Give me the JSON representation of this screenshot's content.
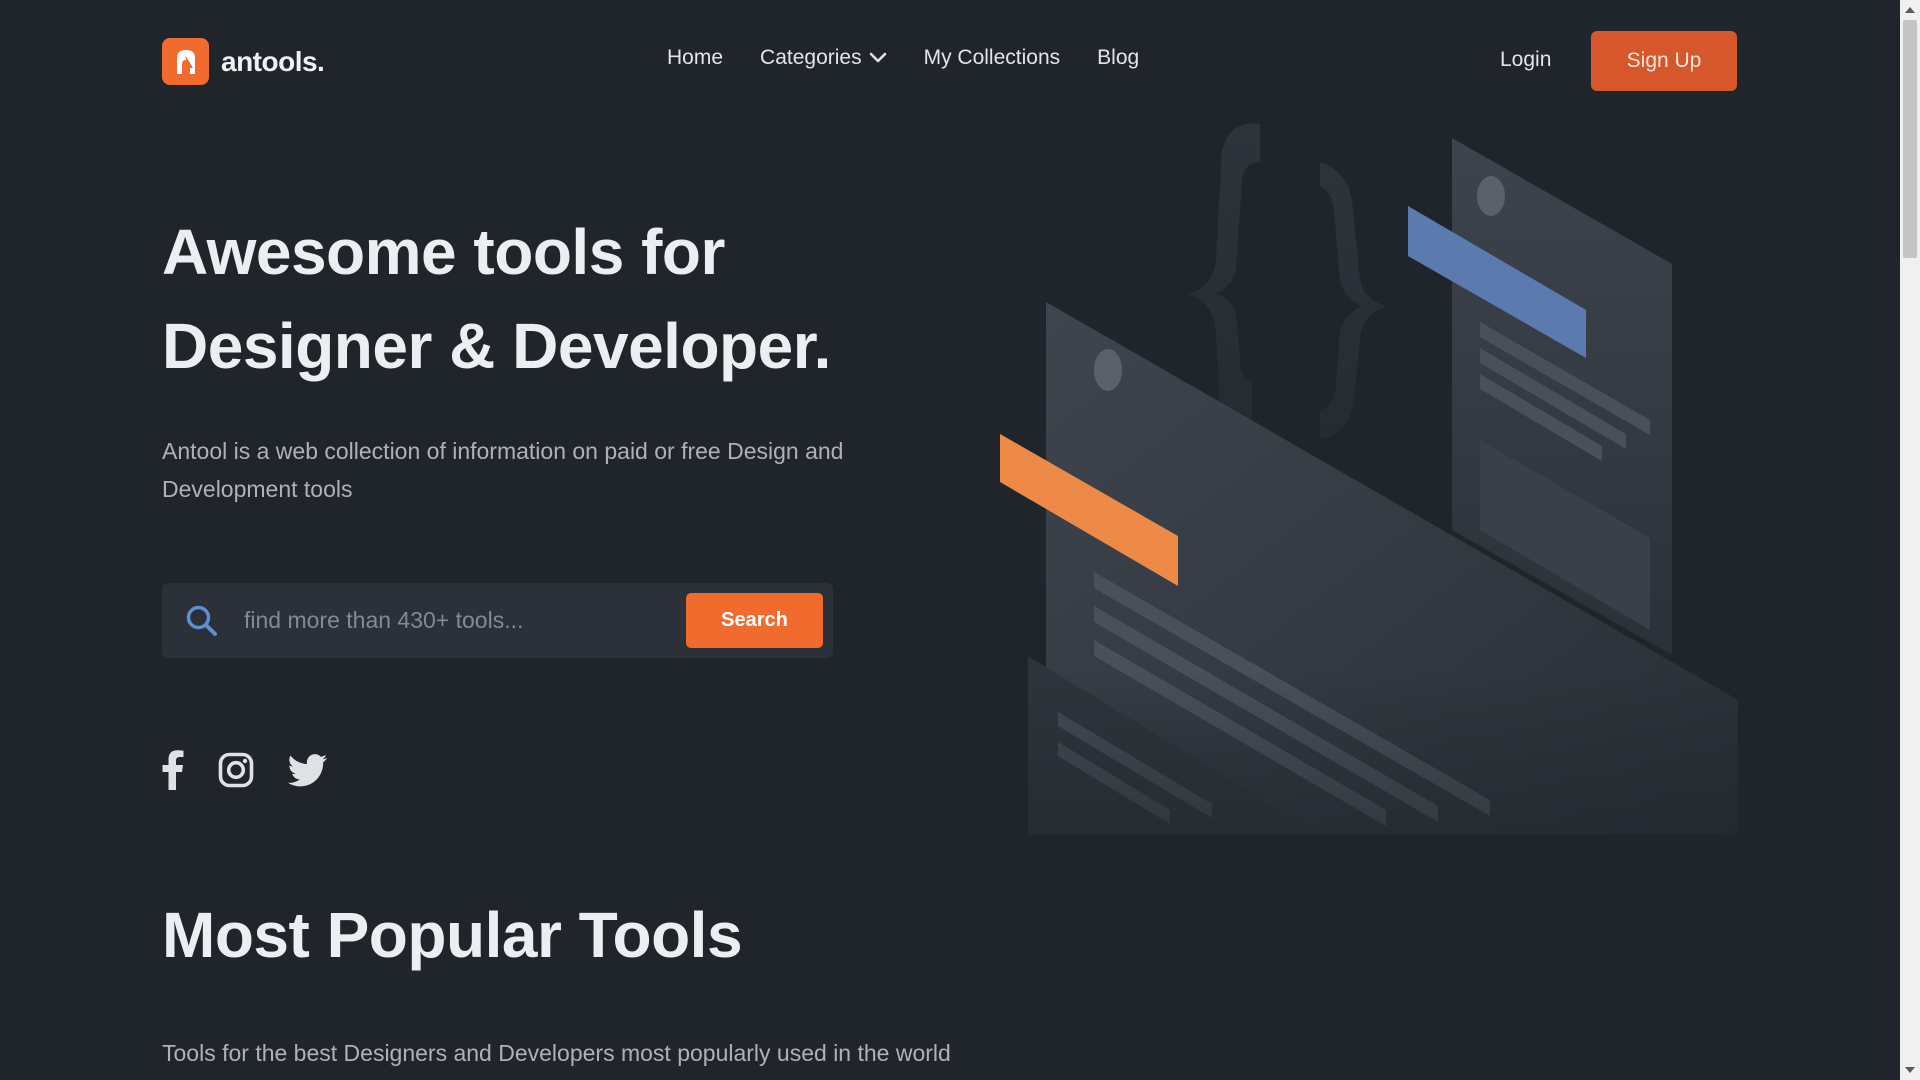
{
  "brand": {
    "name": "antools.",
    "accent": "#f26b2e"
  },
  "nav": {
    "links": [
      {
        "label": "Home"
      },
      {
        "label": "Categories"
      },
      {
        "label": "My Collections"
      },
      {
        "label": "Blog"
      }
    ],
    "login_label": "Login",
    "signup_label": "Sign Up"
  },
  "hero": {
    "title_line1": "Awesome tools for",
    "title_line2": "Designer & Developer.",
    "description": "Antool is a web collection of information on paid or free Design and Development tools"
  },
  "search": {
    "placeholder": "find more than 430+ tools...",
    "value": "",
    "button_label": "Search",
    "icon": "search-icon"
  },
  "socials": [
    {
      "icon": "facebook-icon"
    },
    {
      "icon": "instagram-icon"
    },
    {
      "icon": "twitter-icon"
    }
  ],
  "popular": {
    "title": "Most Popular Tools",
    "description": "Tools for the best Designers and Developers most popularly used in the world"
  },
  "colors": {
    "background": "#20252c",
    "orange": "#f26b2e",
    "signup": "#d6572b",
    "blue_accent": "#5b7bb0"
  }
}
